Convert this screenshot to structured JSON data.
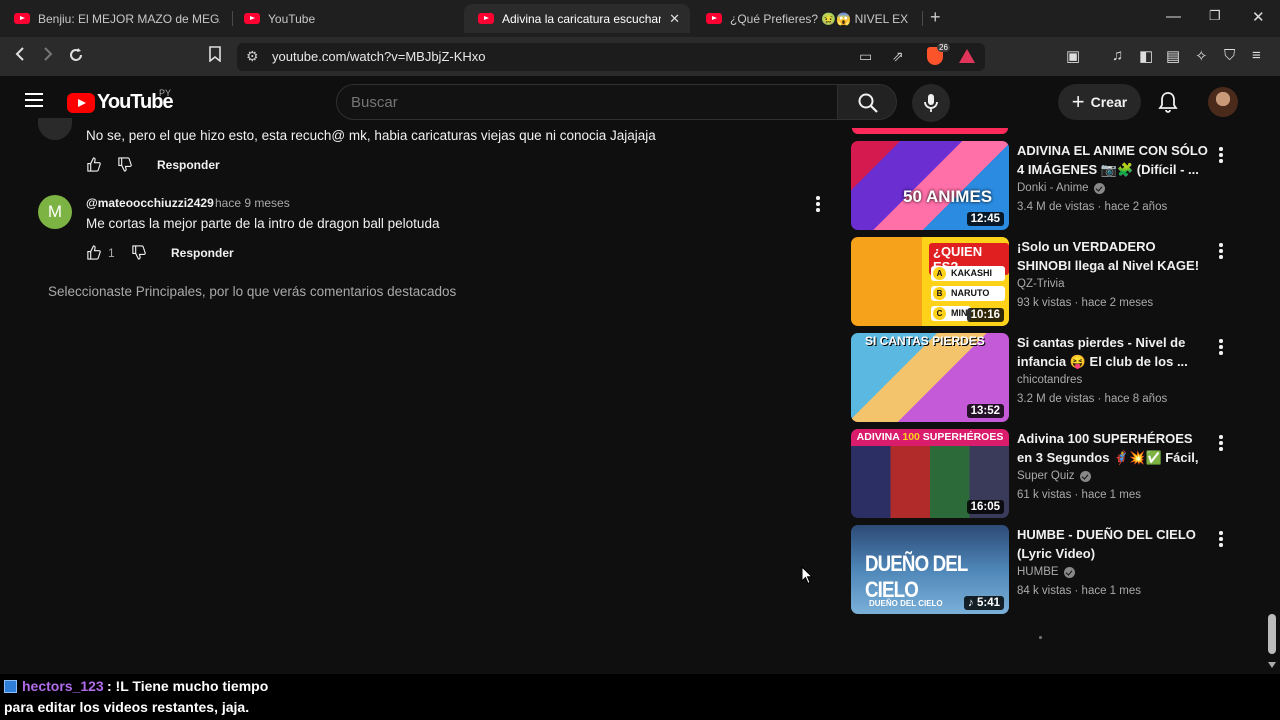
{
  "browser": {
    "tabs": [
      {
        "title": "Benjiu: El MEJOR MAZO de MEGACA",
        "active": false
      },
      {
        "title": "YouTube",
        "active": false
      },
      {
        "title": "Adivina la caricatura escuchando",
        "active": true
      },
      {
        "title": "¿Qué Prefieres? 🤢😱 NIVEL EXTREM",
        "active": false
      }
    ],
    "url": "youtube.com/watch?v=MBJbjZ-KHxo",
    "brave_count": "26"
  },
  "masthead": {
    "logo_text": "YouTube",
    "country": "PY",
    "search_placeholder": "Buscar",
    "create_label": "Crear"
  },
  "comments": [
    {
      "text": "No se, pero el que hizo esto, esta recuch@ mk, habia caricaturas viejas que ni conocia Jajajaja",
      "reply_label": "Responder"
    },
    {
      "avatar_letter": "M",
      "author": "@mateoocchiuzzi2429",
      "time": "hace 9 meses",
      "text": "Me cortas la mejor parte de la intro de dragon ball pelotuda",
      "likes": "1",
      "reply_label": "Responder"
    }
  ],
  "comments_note": "Seleccionaste Principales, por lo que verás comentarios destacados",
  "sidebar_videos": [
    {
      "title": "ADIVINA EL ANIME CON SÓLO 4 IMÁGENES 📷🧩 (Difícil - ...",
      "channel": "Donki - Anime",
      "verified": true,
      "meta": "3.4 M de vistas · hace 2 años",
      "duration": "12:45",
      "thumb_text": "50 ANIMES"
    },
    {
      "title": "¡Solo un VERDADERO SHINOBI llega al Nivel KAGE! 🍥 Quiz d...",
      "channel": "QZ-Trivia",
      "verified": false,
      "meta": "93 k vistas · hace 2 meses",
      "duration": "10:16",
      "thumb_text": "¿QUIEN ES?",
      "thumb_options": [
        {
          "letter": "A",
          "label": "KAKASHI"
        },
        {
          "letter": "B",
          "label": "NARUTO"
        },
        {
          "letter": "C",
          "label": "MIN"
        }
      ]
    },
    {
      "title": "Si cantas pierdes - Nivel de infancia 😝 El club de los ...",
      "channel": "chicotandres",
      "verified": false,
      "meta": "3.2 M de vistas · hace 8 años",
      "duration": "13:52",
      "thumb_text": "SI CANTAS PIERDES"
    },
    {
      "title": "Adivina 100 SUPERHÉROES en 3 Segundos 🦸💥✅ Fácil, ...",
      "channel": "Super Quiz",
      "verified": true,
      "meta": "61 k vistas · hace 1 mes",
      "duration": "16:05",
      "thumb_text_a": "ADIVINA ",
      "thumb_text_b": "100",
      "thumb_text_c": " SUPERHÉROES"
    },
    {
      "title": "HUMBE - DUEÑO DEL CIELO (Lyric Video)",
      "channel": "HUMBE",
      "verified": true,
      "meta": "84 k vistas · hace 1 mes",
      "duration": "♪ 5:41",
      "thumb_text": "DUEÑO DEL CIELO",
      "thumb_subtext": "DUEÑO DEL CIELO"
    }
  ],
  "chat": {
    "user": "hectors_123",
    "line1": ": !L Tiene mucho tiempo",
    "line2": "para editar los videos restantes, jaja."
  }
}
